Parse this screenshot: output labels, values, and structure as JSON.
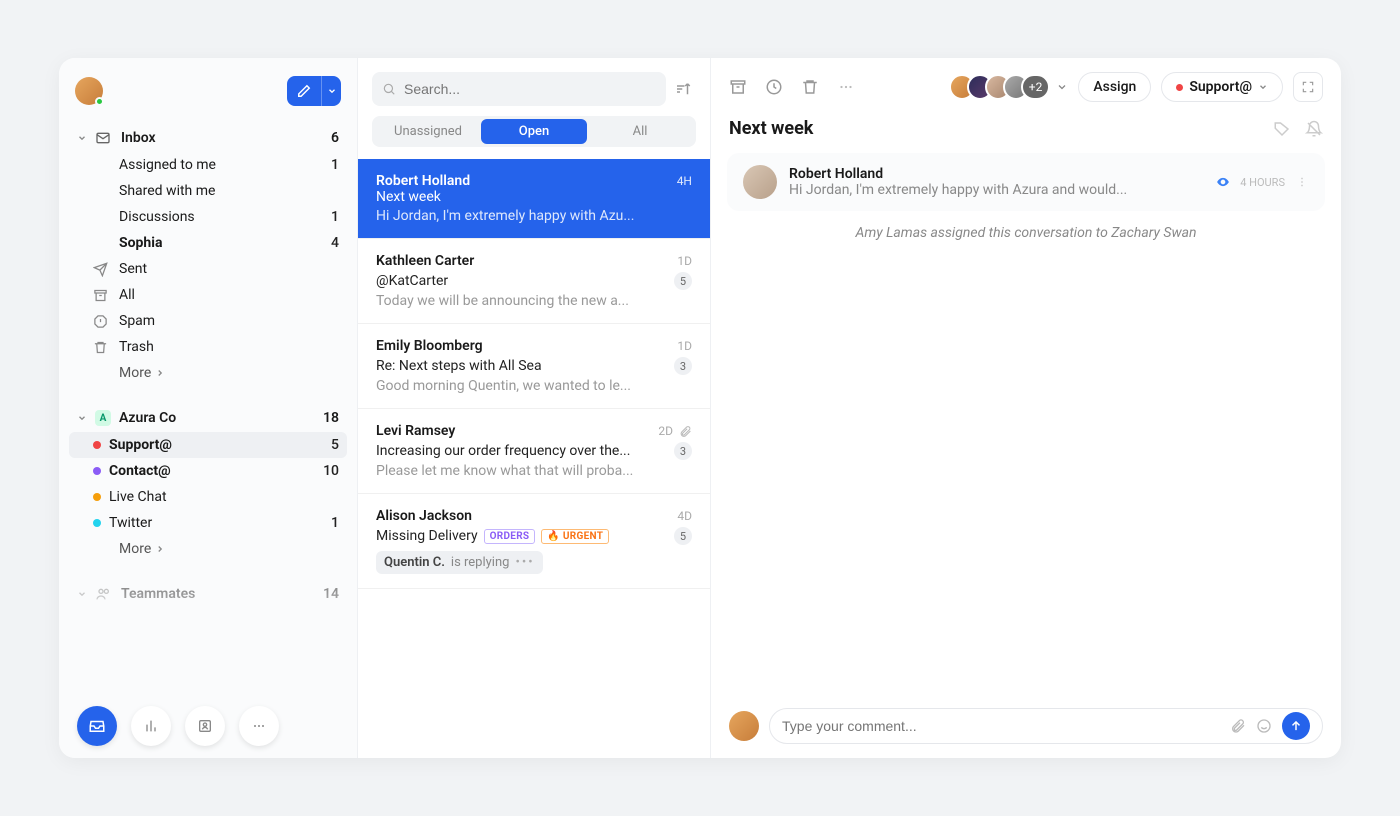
{
  "search": {
    "placeholder": "Search..."
  },
  "segments": {
    "unassigned": "Unassigned",
    "open": "Open",
    "all": "All"
  },
  "sidebar": {
    "inbox": {
      "label": "Inbox",
      "count": "6",
      "items": [
        {
          "label": "Assigned to me",
          "count": "1"
        },
        {
          "label": "Shared with me",
          "count": ""
        },
        {
          "label": "Discussions",
          "count": "1"
        },
        {
          "label": "Sophia",
          "count": "4"
        }
      ]
    },
    "folders": {
      "sent": "Sent",
      "all": "All",
      "spam": "Spam",
      "trash": "Trash",
      "more": "More"
    },
    "azura": {
      "label": "Azura Co",
      "badge": "A",
      "count": "18",
      "items": [
        {
          "label": "Support@",
          "count": "5"
        },
        {
          "label": "Contact@",
          "count": "10"
        },
        {
          "label": "Live Chat",
          "count": ""
        },
        {
          "label": "Twitter",
          "count": "1"
        }
      ],
      "more": "More"
    },
    "teammates": {
      "label": "Teammates",
      "count": "14"
    }
  },
  "convos": [
    {
      "sender": "Robert Holland",
      "time": "4H",
      "subject": "Next week",
      "preview": "Hi Jordan, I'm extremely happy with Azu..."
    },
    {
      "sender": "Kathleen Carter",
      "time": "1D",
      "subject": "@KatCarter",
      "preview": "Today we will be announcing the new a...",
      "badge": "5"
    },
    {
      "sender": "Emily Bloomberg",
      "time": "1D",
      "subject": "Re: Next steps with All Sea",
      "preview": "Good morning Quentin, we wanted to le...",
      "badge": "3"
    },
    {
      "sender": "Levi Ramsey",
      "time": "2D",
      "subject": "Increasing our order frequency over the...",
      "preview": "Please let me know what that will proba...",
      "badge": "3",
      "attach": true
    },
    {
      "sender": "Alison Jackson",
      "time": "4D",
      "subject": "Missing Delivery",
      "tags": [
        "ORDERS",
        "🔥 URGENT"
      ],
      "badge": "5",
      "replying_strong": "Quentin C.",
      "replying_light": "is replying"
    }
  ],
  "detail": {
    "title": "Next week",
    "assignBtn": "Assign",
    "channel": "Support@",
    "participants_extra": "+2",
    "message": {
      "from": "Robert Holland",
      "text": "Hi Jordan, I'm extremely happy with Azura and would...",
      "time": "4 HOURS"
    },
    "system": "Amy Lamas assigned this conversation to Zachary Swan",
    "comment_placeholder": "Type your comment..."
  }
}
